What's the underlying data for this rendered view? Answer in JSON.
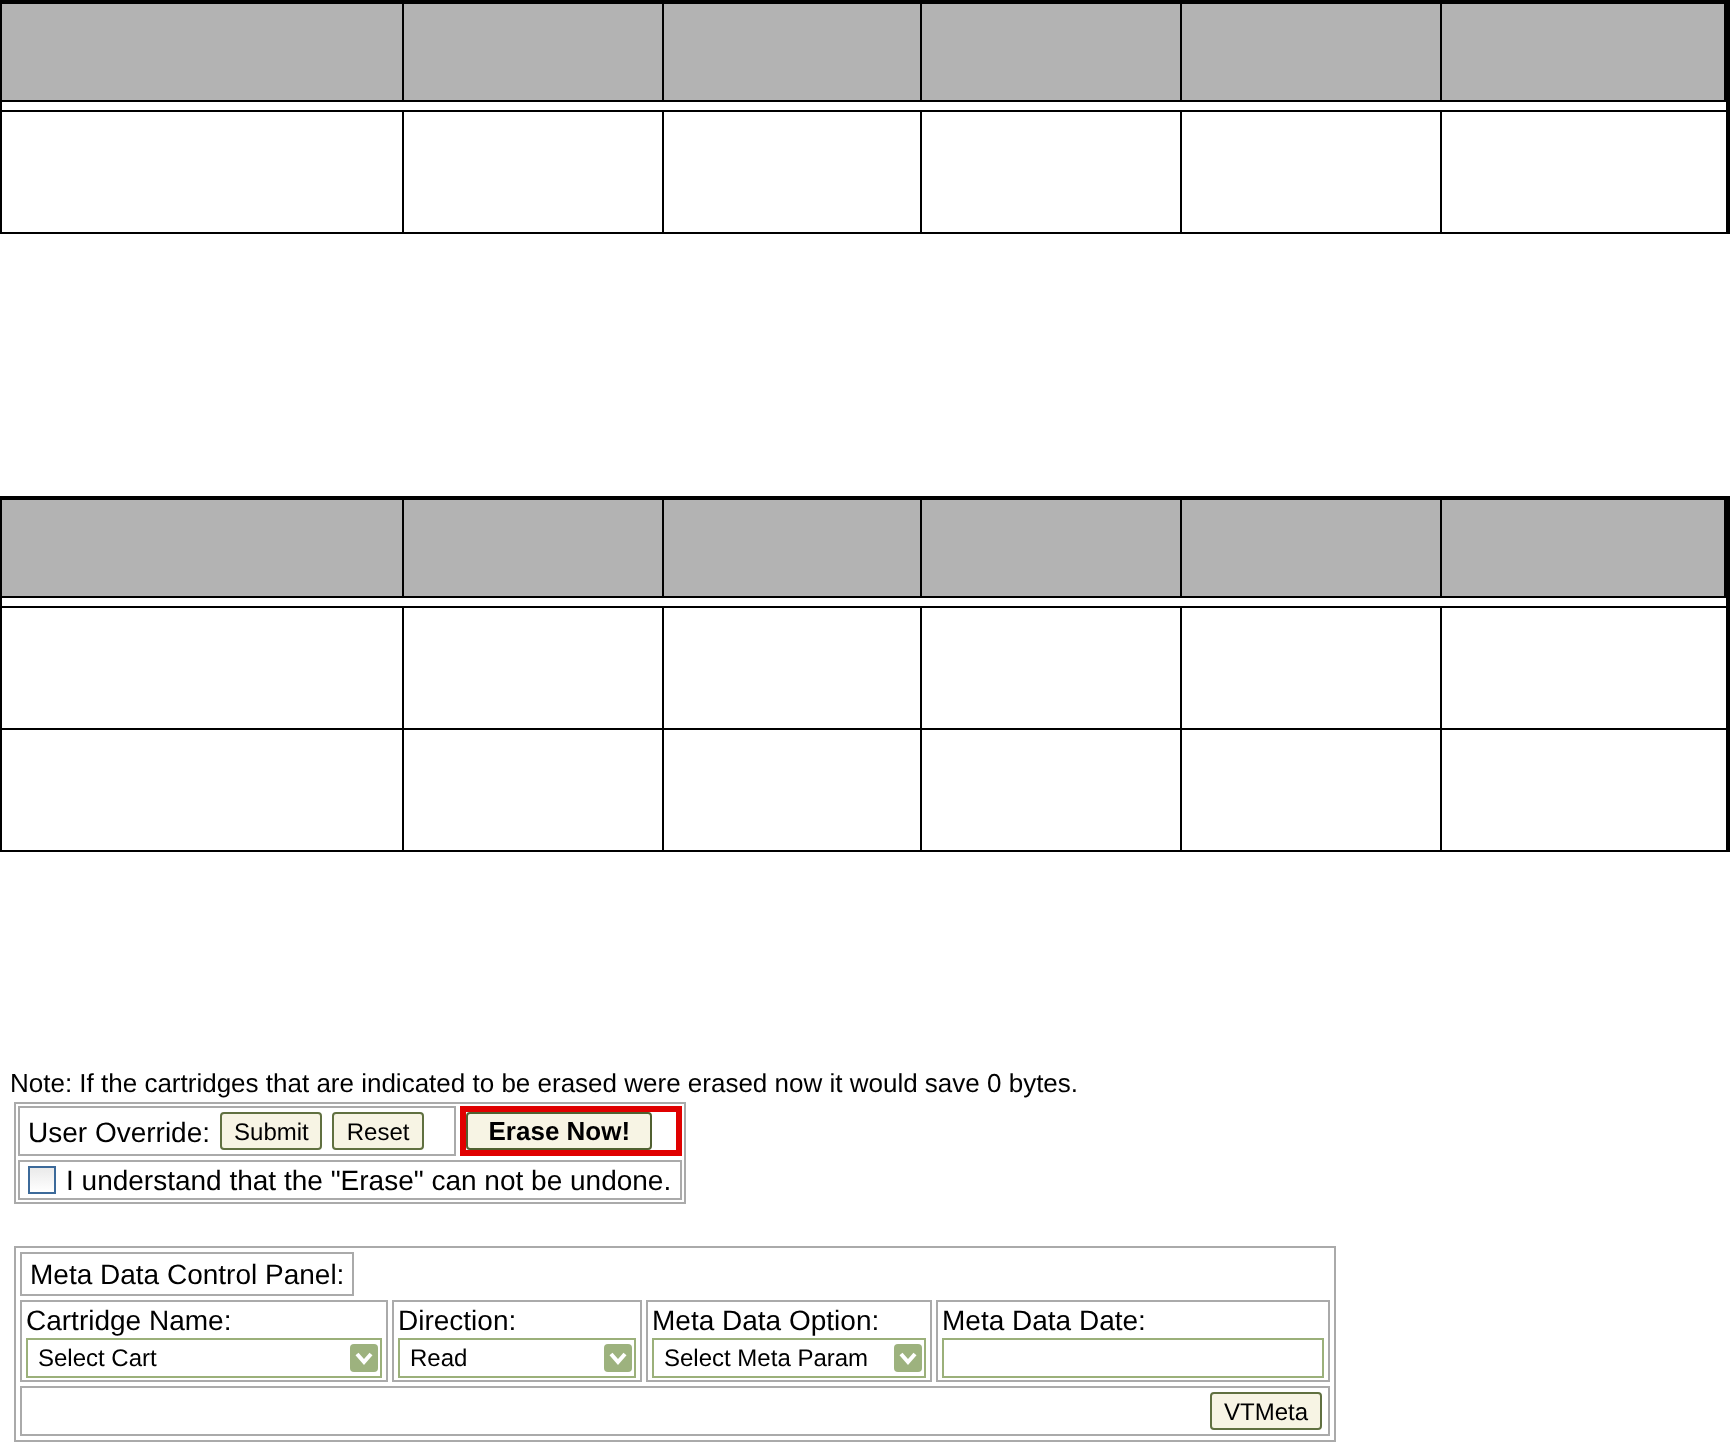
{
  "tables": [
    {
      "columns": [
        {
          "kind": "blank"
        },
        {
          "kind": "blank"
        },
        {
          "kind": "blank"
        },
        {
          "kind": "blank"
        },
        {
          "kind": "blank"
        },
        {
          "kind": "blank"
        }
      ],
      "rows": [
        {
          "kind": "blank"
        }
      ]
    },
    {
      "columns": [
        {
          "kind": "blank"
        },
        {
          "kind": "blank"
        },
        {
          "kind": "blank"
        },
        {
          "kind": "blank"
        },
        {
          "kind": "blank"
        },
        {
          "kind": "blank"
        }
      ],
      "rows": [
        {
          "kind": "blank"
        },
        {
          "kind": "blank"
        }
      ]
    }
  ],
  "note": "Note: If the cartridges that are indicated to be erased were erased now it would save 0 bytes.",
  "override": {
    "label": "User Override:",
    "buttons": [
      "Submit",
      "Reset"
    ],
    "erase_button": "Erase Now!",
    "confirm": {
      "label": "I understand that the \"Erase\" can not be undone.",
      "checked": false
    }
  },
  "meta_panel": {
    "title": "Meta Data Control Panel:",
    "fields": [
      {
        "kind": "select",
        "label": "Cartridge Name:",
        "value": "Select Cart"
      },
      {
        "kind": "select",
        "label": "Direction:",
        "value": "Read"
      },
      {
        "kind": "select",
        "label": "Meta Data Option:",
        "value": "Select Meta Param"
      },
      {
        "kind": "text",
        "label": "Meta Data Date:"
      }
    ],
    "button": "VTMeta"
  }
}
